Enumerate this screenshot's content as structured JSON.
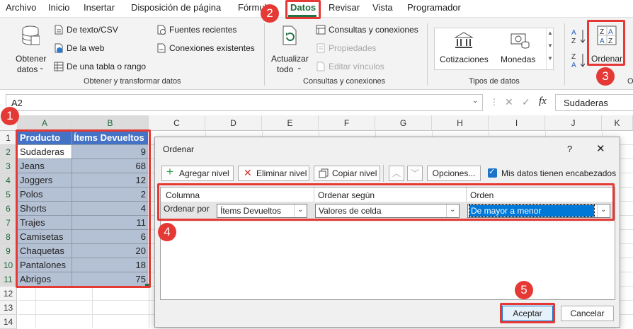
{
  "menu": [
    "Archivo",
    "Inicio",
    "Insertar",
    "Disposición de página",
    "Fórmulas",
    "Datos",
    "Revisar",
    "Vista",
    "Programador"
  ],
  "ribbon": {
    "obtener_datos": "Obtener",
    "obtener_datos2": "datos",
    "de_texto": "De texto/CSV",
    "de_web": "De la web",
    "de_tabla": "De una tabla o rango",
    "fuentes_recientes": "Fuentes recientes",
    "conexiones_existentes": "Conexiones existentes",
    "grupo_obtener": "Obtener y transformar datos",
    "actualizar": "Actualizar",
    "actualizar2": "todo",
    "consultas_conexiones": "Consultas y conexiones",
    "propiedades": "Propiedades",
    "editar_vinculos": "Editar vínculos",
    "grupo_consultas": "Consultas y conexiones",
    "cotizaciones": "Cotizaciones",
    "monedas": "Monedas",
    "grupo_tipos": "Tipos de datos",
    "ordenar": "Ordenar",
    "grupo_ordenar": "O"
  },
  "formula_bar": {
    "name_box": "A2",
    "fx": "fx",
    "value": "Sudaderas"
  },
  "columns": [
    "A",
    "B",
    "C",
    "D",
    "E",
    "F",
    "G",
    "H",
    "I",
    "J",
    "K"
  ],
  "rows": [
    "1",
    "2",
    "3",
    "4",
    "5",
    "6",
    "7",
    "8",
    "9",
    "10",
    "11",
    "12",
    "13",
    "14"
  ],
  "table": {
    "headers": [
      "Producto",
      "Ítems Devueltos"
    ],
    "products": [
      "Sudaderas",
      "Jeans",
      "Joggers",
      "Polos",
      "Shorts",
      "Trajes",
      "Camisetas",
      "Chaquetas",
      "Pantalones",
      "Abrigos"
    ],
    "values": [
      "9",
      "68",
      "12",
      "2",
      "4",
      "11",
      "6",
      "20",
      "18",
      "75"
    ]
  },
  "dialog": {
    "title": "Ordenar",
    "help": "?",
    "close": "✕",
    "add_level": "Agregar nivel",
    "delete_level": "Eliminar nivel",
    "copy_level": "Copiar nivel",
    "options": "Opciones...",
    "has_headers": "Mis datos tienen encabezados",
    "col_header": "Columna",
    "sort_on_header": "Ordenar según",
    "order_header": "Orden",
    "sort_by_label": "Ordenar por",
    "column_value": "Ítems Devueltos",
    "sort_on_value": "Valores de celda",
    "order_value": "De mayor a menor",
    "ok": "Aceptar",
    "cancel": "Cancelar"
  },
  "badges": [
    "1",
    "2",
    "3",
    "4",
    "5"
  ],
  "colors": {
    "accent": "#217346",
    "badge": "#e53935",
    "header_fill": "#4472c4",
    "table_fill": "#b4c0d3"
  }
}
